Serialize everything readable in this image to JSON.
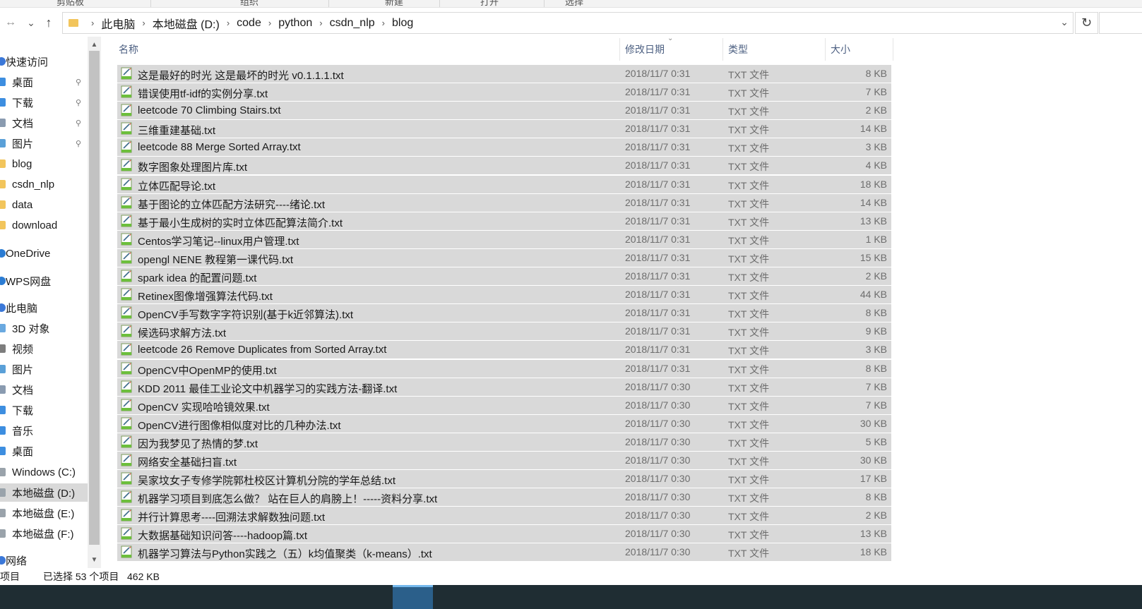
{
  "ribbon": {
    "groups": [
      "剪贴板",
      "组织",
      "新建",
      "打开",
      "选择"
    ]
  },
  "nav": {
    "back_icon": "←",
    "forward_icon": "→",
    "recent_icon": "⌄",
    "up_icon": "↑"
  },
  "address": {
    "crumbs": [
      "此电脑",
      "本地磁盘 (D:)",
      "code",
      "python",
      "csdn_nlp",
      "blog"
    ],
    "separator": "›",
    "dropdown_icon": "⌄",
    "refresh_icon": "↻"
  },
  "sidebar": {
    "items": [
      {
        "label": "快速访问",
        "icon": "star-icon",
        "pinned": false
      },
      {
        "label": "桌面",
        "icon": "desktop-folder-icon",
        "pinned": true
      },
      {
        "label": "下载",
        "icon": "download-folder-icon",
        "pinned": true
      },
      {
        "label": "文档",
        "icon": "documents-folder-icon",
        "pinned": true
      },
      {
        "label": "图片",
        "icon": "pictures-folder-icon",
        "pinned": true
      },
      {
        "label": "blog",
        "icon": "folder-icon",
        "pinned": false
      },
      {
        "label": "csdn_nlp",
        "icon": "folder-icon",
        "pinned": false
      },
      {
        "label": "data",
        "icon": "folder-icon",
        "pinned": false
      },
      {
        "label": "download",
        "icon": "folder-icon",
        "pinned": false
      },
      {
        "label": "OneDrive",
        "icon": "cloud-icon",
        "pinned": false
      },
      {
        "label": "WPS网盘",
        "icon": "cloud-icon",
        "pinned": false
      },
      {
        "label": "此电脑",
        "icon": "computer-icon",
        "pinned": false
      },
      {
        "label": "3D 对象",
        "icon": "3d-objects-icon",
        "pinned": false
      },
      {
        "label": "视频",
        "icon": "video-icon",
        "pinned": false
      },
      {
        "label": "图片",
        "icon": "pictures-folder-icon",
        "pinned": false
      },
      {
        "label": "文档",
        "icon": "documents-folder-icon",
        "pinned": false
      },
      {
        "label": "下载",
        "icon": "download-folder-icon",
        "pinned": false
      },
      {
        "label": "音乐",
        "icon": "music-icon",
        "pinned": false
      },
      {
        "label": "桌面",
        "icon": "desktop-folder-icon",
        "pinned": false
      },
      {
        "label": "Windows (C:)",
        "icon": "drive-icon",
        "pinned": false
      },
      {
        "label": "本地磁盘 (D:)",
        "icon": "drive-icon",
        "pinned": false,
        "selected": true
      },
      {
        "label": "本地磁盘 (E:)",
        "icon": "drive-icon",
        "pinned": false
      },
      {
        "label": "本地磁盘 (F:)",
        "icon": "drive-icon",
        "pinned": false
      },
      {
        "label": "网络",
        "icon": "network-icon",
        "pinned": false
      }
    ],
    "pin_icon": "📌"
  },
  "columns": {
    "name": "名称",
    "date": "修改日期",
    "type": "类型",
    "size": "大小",
    "sort_icon": "⌄"
  },
  "files": [
    {
      "name": "这是最好的时光  这是最坏的时光  v0.1.1.1.txt",
      "date": "2018/11/7 0:31",
      "type": "TXT 文件",
      "size": "8 KB"
    },
    {
      "name": "错误使用tf-idf的实例分享.txt",
      "date": "2018/11/7 0:31",
      "type": "TXT 文件",
      "size": "7 KB"
    },
    {
      "name": "leetcode 70 Climbing Stairs.txt",
      "date": "2018/11/7 0:31",
      "type": "TXT 文件",
      "size": "2 KB"
    },
    {
      "name": "三维重建基础.txt",
      "date": "2018/11/7 0:31",
      "type": "TXT 文件",
      "size": "14 KB"
    },
    {
      "name": "leetcode 88    Merge Sorted Array.txt",
      "date": "2018/11/7 0:31",
      "type": "TXT 文件",
      "size": "3 KB"
    },
    {
      "name": "数字图象处理图片库.txt",
      "date": "2018/11/7 0:31",
      "type": "TXT 文件",
      "size": "4 KB"
    },
    {
      "name": "立体匹配导论.txt",
      "date": "2018/11/7 0:31",
      "type": "TXT 文件",
      "size": "18 KB"
    },
    {
      "name": "基于图论的立体匹配方法研究----绪论.txt",
      "date": "2018/11/7 0:31",
      "type": "TXT 文件",
      "size": "14 KB"
    },
    {
      "name": "基于最小生成树的实时立体匹配算法简介.txt",
      "date": "2018/11/7 0:31",
      "type": "TXT 文件",
      "size": "13 KB"
    },
    {
      "name": "Centos学习笔记--linux用户管理.txt",
      "date": "2018/11/7 0:31",
      "type": "TXT 文件",
      "size": "1 KB"
    },
    {
      "name": "opengl NENE 教程第一课代码.txt",
      "date": "2018/11/7 0:31",
      "type": "TXT 文件",
      "size": "15 KB"
    },
    {
      "name": "spark idea 的配置问题.txt",
      "date": "2018/11/7 0:31",
      "type": "TXT 文件",
      "size": "2 KB"
    },
    {
      "name": "Retinex图像增强算法代码.txt",
      "date": "2018/11/7 0:31",
      "type": "TXT 文件",
      "size": "44 KB"
    },
    {
      "name": "OpenCV手写数字字符识别(基于k近邻算法).txt",
      "date": "2018/11/7 0:31",
      "type": "TXT 文件",
      "size": "8 KB"
    },
    {
      "name": "候选码求解方法.txt",
      "date": "2018/11/7 0:31",
      "type": "TXT 文件",
      "size": "9 KB"
    },
    {
      "name": "leetcode 26 Remove Duplicates from Sorted Array.txt",
      "date": "2018/11/7 0:31",
      "type": "TXT 文件",
      "size": "3 KB"
    },
    {
      "name": "OpenCV中OpenMP的使用.txt",
      "date": "2018/11/7 0:31",
      "type": "TXT 文件",
      "size": "8 KB"
    },
    {
      "name": "KDD 2011 最佳工业论文中机器学习的实践方法-翻译.txt",
      "date": "2018/11/7 0:30",
      "type": "TXT 文件",
      "size": "7 KB"
    },
    {
      "name": "OpenCV 实现哈哈镜效果.txt",
      "date": "2018/11/7 0:30",
      "type": "TXT 文件",
      "size": "7 KB"
    },
    {
      "name": "OpenCV进行图像相似度对比的几种办法.txt",
      "date": "2018/11/7 0:30",
      "type": "TXT 文件",
      "size": "30 KB"
    },
    {
      "name": "因为我梦见了热情的梦.txt",
      "date": "2018/11/7 0:30",
      "type": "TXT 文件",
      "size": "5 KB"
    },
    {
      "name": "网络安全基础扫盲.txt",
      "date": "2018/11/7 0:30",
      "type": "TXT 文件",
      "size": "30 KB"
    },
    {
      "name": "吴家坟女子专修学院郭杜校区计算机分院的学年总结.txt",
      "date": "2018/11/7 0:30",
      "type": "TXT 文件",
      "size": "17 KB"
    },
    {
      "name": "机器学习项目到底怎么做？  站在巨人的肩膀上！-----资料分享.txt",
      "date": "2018/11/7 0:30",
      "type": "TXT 文件",
      "size": "8 KB"
    },
    {
      "name": "并行计算思考----回溯法求解数独问题.txt",
      "date": "2018/11/7 0:30",
      "type": "TXT 文件",
      "size": "2 KB"
    },
    {
      "name": "大数据基础知识问答----hadoop篇.txt",
      "date": "2018/11/7 0:30",
      "type": "TXT 文件",
      "size": "13 KB"
    },
    {
      "name": "机器学习算法与Python实践之（五）k均值聚类（k-means）.txt",
      "date": "2018/11/7 0:30",
      "type": "TXT 文件",
      "size": "18 KB"
    }
  ],
  "status": {
    "item_count": "个项目",
    "selection": "已选择 53 个项目",
    "selection_size": "462 KB"
  },
  "colors": {
    "selected_row": "#d9d9d9",
    "header_text": "#4d6082",
    "taskbar": "#1f2d33",
    "folder": "#f2c55c"
  }
}
